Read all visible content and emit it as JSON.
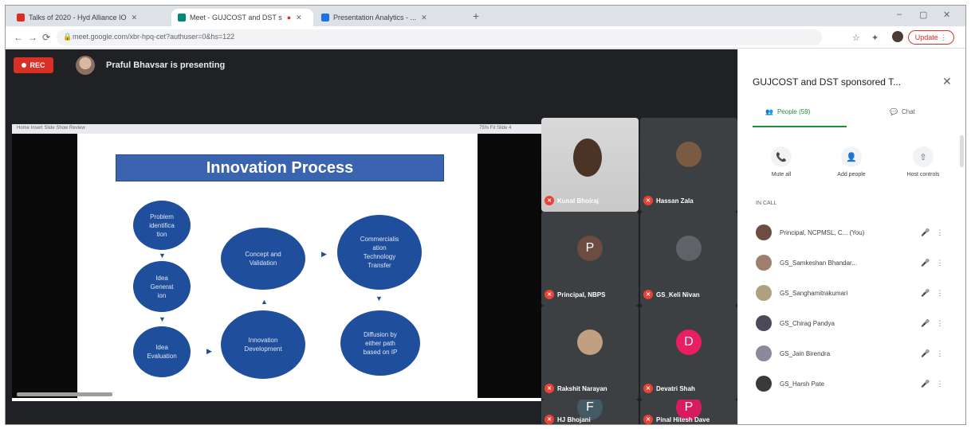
{
  "browser": {
    "tabs": [
      {
        "label": "Talks of 2020 - Hyd Alliance IO",
        "color": "#d93025",
        "active": false
      },
      {
        "label": "Meet - GUJCOST and DST s",
        "color": "#00897b",
        "active": true
      },
      {
        "label": "Presentation Analytics - ...",
        "color": "#1a73e8",
        "active": false
      }
    ],
    "new_tab": "+",
    "window_controls": {
      "minimize": "–",
      "maximize": "▢",
      "close": "✕"
    },
    "nav": {
      "back": "←",
      "forward": "→",
      "reload": "⟳"
    },
    "url": "meet.google.com/xbr-hpq-cet?authuser=0&hs=122",
    "lock": "🔒",
    "update_label": "Update ⋮",
    "icon_names": [
      "star-icon",
      "extension-icon",
      "profile-avatar"
    ]
  },
  "meet": {
    "rec_label": "REC",
    "presenter": "Praful Bhavsar is presenting",
    "shared_tabs": "Home   Insert   Slide Show   Review",
    "shared_tabs_right": "75%   Fit   Slide 4",
    "slide": {
      "title": "Innovation Process",
      "circles": [
        "Problem\nidentifica\ntion",
        "Idea\nGenerat\nion",
        "Idea\nEvaluation",
        "Concept and\nValidation",
        "Innovation\nDevelopment",
        "Commercialis\nation\nTechnology\nTransfer",
        "Diffusion by\neither path\nbased on IP"
      ],
      "arrow_down": "▼",
      "arrow_right": "▶",
      "arrow_up": "▲"
    },
    "tiles": [
      {
        "name": "Kunal Bhoiraj",
        "initial": "",
        "color": "#c8c8c8",
        "photo": true
      },
      {
        "name": "Hassan Zala",
        "initial": "",
        "color": "#7a5a40",
        "photo": false
      },
      {
        "name": "Principal, NBPS",
        "initial": "P",
        "color": "#6d4c41",
        "photo": false
      },
      {
        "name": "GS_Keli Nivan",
        "initial": "",
        "color": "#5f6368",
        "photo": false
      },
      {
        "name": "Rakshit Narayan",
        "initial": "",
        "color": "#c0a080",
        "photo": false
      },
      {
        "name": "Devatri Shah",
        "initial": "D",
        "color": "#e91e63",
        "photo": false
      },
      {
        "name": "HJ Bhojani",
        "initial": "F",
        "color": "#455a64",
        "photo": false
      },
      {
        "name": "Pinal Hitesh Dave",
        "initial": "P",
        "color": "#d81b60",
        "photo": false
      }
    ],
    "mic_off": "✕"
  },
  "panel": {
    "title": "GUJCOST and DST sponsored T...",
    "close": "✕",
    "tabs": {
      "people": "People (59)",
      "chat": "Chat"
    },
    "quick_actions": [
      {
        "icon": "📞",
        "label": "Mute all"
      },
      {
        "icon": "👤",
        "label": "Add people"
      },
      {
        "icon": "⇧",
        "label": "Host controls"
      }
    ],
    "section": "IN CALL",
    "participants": [
      {
        "name": "Principal, NCPMSL, C... (You)",
        "color": "#6d4c41"
      },
      {
        "name": "GS_Samkeshan Bhandar...",
        "color": "#9e7e6e"
      },
      {
        "name": "GS_Sanghamitrakumari",
        "color": "#b0a080"
      },
      {
        "name": "GS_Chirag Pandya",
        "color": "#4a4a5a"
      },
      {
        "name": "GS_Jain Birendra",
        "color": "#8a8a9a"
      },
      {
        "name": "GS_Harsh Pate",
        "color": "#3a3a3a"
      }
    ],
    "mic_icon": "🎤",
    "more_icon": "⋮"
  }
}
